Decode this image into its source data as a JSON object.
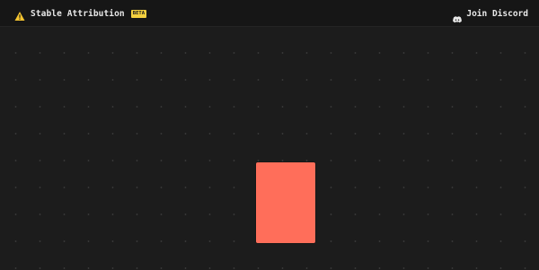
{
  "header": {
    "brand_icon": "warning-triangle-icon",
    "brand_name": "Stable Attribution",
    "badge": "BETA",
    "badge_color": "#f4d03f",
    "discord_icon": "discord-icon",
    "discord_label": "Join Discord"
  },
  "main": {
    "image_placeholder_color": "#ff6e5a"
  }
}
